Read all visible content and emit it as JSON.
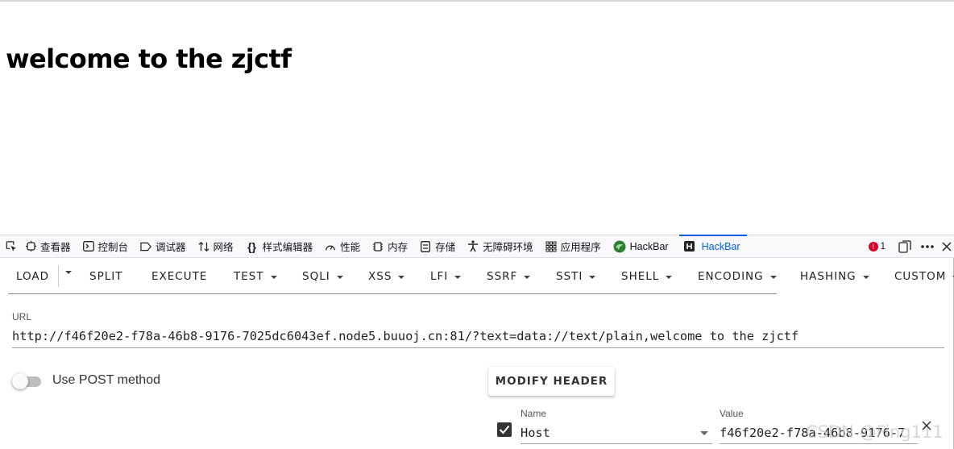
{
  "page": {
    "heading": "welcome to the zjctf"
  },
  "devtools": {
    "tabs": [
      {
        "label": "查看器",
        "icon": "inspector-icon"
      },
      {
        "label": "控制台",
        "icon": "console-icon"
      },
      {
        "label": "调试器",
        "icon": "debugger-icon"
      },
      {
        "label": "网络",
        "icon": "network-icon"
      },
      {
        "label": "样式编辑器",
        "icon": "style-editor-icon"
      },
      {
        "label": "性能",
        "icon": "performance-icon"
      },
      {
        "label": "内存",
        "icon": "memory-icon"
      },
      {
        "label": "存储",
        "icon": "storage-icon"
      },
      {
        "label": "无障碍环境",
        "icon": "accessibility-icon"
      },
      {
        "label": "应用程序",
        "icon": "application-icon"
      },
      {
        "label": "HackBar",
        "icon": "hackbar-green-icon"
      },
      {
        "label": "HackBar",
        "icon": "hackbar-h-icon",
        "active": true
      }
    ],
    "error_count": "1",
    "accent_color": "#0060df"
  },
  "hackbar": {
    "toolbar": {
      "load": "LOAD",
      "split": "SPLIT",
      "execute": "EXECUTE",
      "test": "TEST",
      "sqli": "SQLI",
      "xss": "XSS",
      "lfi": "LFI",
      "ssrf": "SSRF",
      "ssti": "SSTI",
      "shell": "SHELL",
      "encoding": "ENCODING",
      "hashing": "HASHING",
      "custom": "CUSTOM"
    },
    "url_label": "URL",
    "url_value": "http://f46f20e2-f78a-46b8-9176-7025dc6043ef.node5.buuoj.cn:81/?text=data://text/plain,welcome to the zjctf",
    "post_toggle_label": "Use POST method",
    "post_enabled": false,
    "modify_header_label": "MODIFY HEADER",
    "header_row": {
      "enabled": true,
      "name_label": "Name",
      "name_value": "Host",
      "value_label": "Value",
      "value_value": "f46f20e2-f78a-46b8-9176-7"
    }
  },
  "watermark": "CSDN @Fing111"
}
